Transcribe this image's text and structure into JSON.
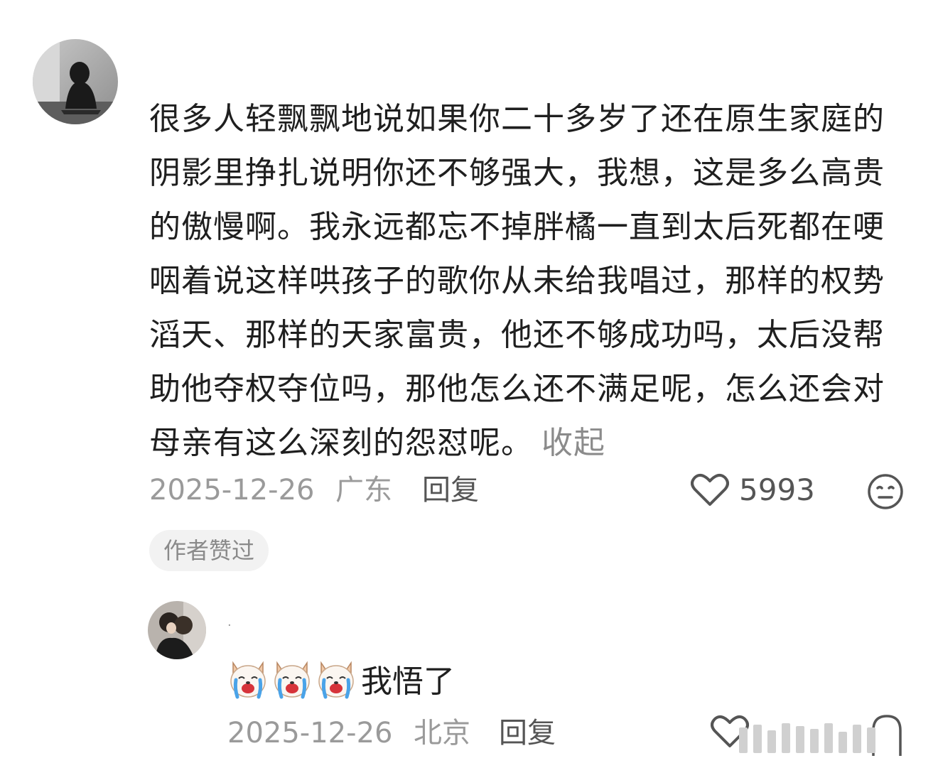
{
  "main_comment": {
    "avatar_icon": "hooded-figure-avatar",
    "text": "很多人轻飘飘地说如果你二十多岁了还在原生家庭的阴影里挣扎说明你还不够强大，我想，这是多么高贵的傲慢啊。我永远都忘不掉胖橘一直到太后死都在哽咽着说这样哄孩子的歌你从未给我唱过，那样的权势滔天、那样的天家富贵，他还不够成功吗，太后没帮助他夺权夺位吗，那他怎么还不满足呢，怎么还会对母亲有这么深刻的怨怼呢。",
    "collapse_label": "收起",
    "date": "2025-12-26",
    "location": "广东",
    "reply_label": "回复",
    "like_count": "5993",
    "like_icon": "heart-outline-icon",
    "emoji_icon": "neutral-face-icon",
    "author_badge": "作者赞过"
  },
  "reply_comment": {
    "avatar_icon": "couple-photo-avatar",
    "username": "·",
    "stickers": [
      "crying-dog-sticker",
      "crying-dog-sticker",
      "crying-dog-sticker"
    ],
    "text": "我悟了",
    "date": "2025-12-26",
    "location": "北京",
    "reply_label": "回复"
  },
  "colors": {
    "text_primary": "#1f1f1f",
    "text_secondary": "#9a9a9a",
    "badge_bg": "#f2f2f2"
  }
}
